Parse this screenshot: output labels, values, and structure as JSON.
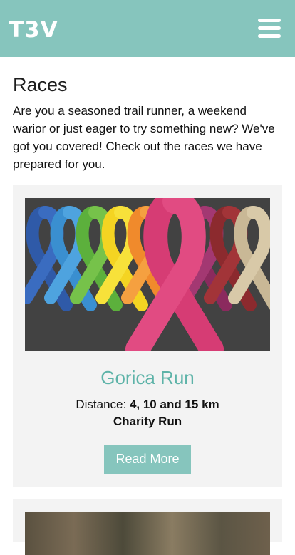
{
  "header": {
    "logo": "T3V",
    "menu_icon": "hamburger-menu-icon",
    "background": "#86c5bd"
  },
  "main": {
    "title": "Races",
    "intro": "Are you a seasoned trail runner, a weekend warior or just eager to try something new? We've got you covered! Check out the races we have prepared for you."
  },
  "races": [
    {
      "image": "colored-awareness-ribbons",
      "title": "Gorica Run",
      "distance_label": "Distance: ",
      "distance_value": "4, 10 and 15 km",
      "type": "Charity Run",
      "button": "Read More"
    },
    {
      "image": "trail-photo"
    }
  ],
  "colors": {
    "accent": "#86c5bd",
    "title_teal": "#5db3a8",
    "card_bg": "#f3f3f3"
  }
}
